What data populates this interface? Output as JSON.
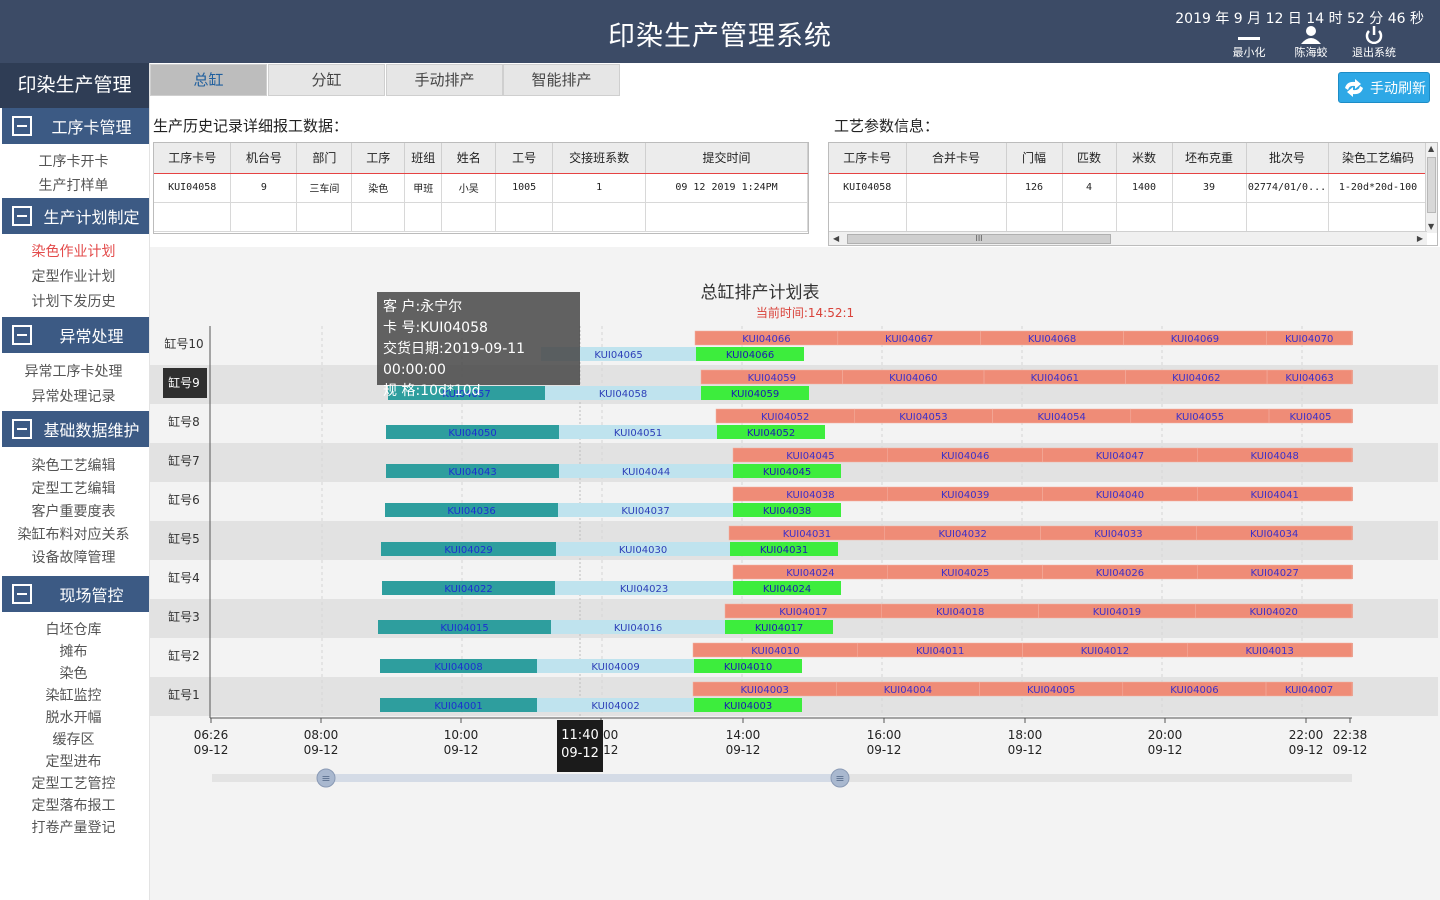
{
  "header": {
    "title": "印染生产管理系统",
    "clock": "2019 年 9 月 12 日  14 时 52 分 46 秒",
    "minimize_label": "最小化",
    "user_label": "陈海蛟",
    "exit_label": "退出系统",
    "icons": [
      "minimize-icon",
      "user-icon",
      "power-icon"
    ]
  },
  "sidebar": {
    "title": "印染生产管理",
    "sections": [
      {
        "label": "工序卡管理",
        "items": [
          {
            "label": "工序卡开卡"
          },
          {
            "label": "生产打样单"
          }
        ]
      },
      {
        "label": "生产计划制定",
        "items": [
          {
            "label": "染色作业计划",
            "active": true
          },
          {
            "label": "定型作业计划"
          },
          {
            "label": "计划下发历史"
          }
        ]
      },
      {
        "label": "异常处理",
        "items": [
          {
            "label": "异常工序卡处理"
          },
          {
            "label": "异常处理记录"
          }
        ]
      },
      {
        "label": "基础数据维护",
        "items": [
          {
            "label": "染色工艺编辑"
          },
          {
            "label": "定型工艺编辑"
          },
          {
            "label": "客户重要度表"
          },
          {
            "label": "染缸布料对应关系"
          },
          {
            "label": "设备故障管理"
          }
        ]
      },
      {
        "label": "现场管控",
        "items": [
          {
            "label": "白坯仓库"
          },
          {
            "label": "摊布"
          },
          {
            "label": "染色"
          },
          {
            "label": "染缸监控"
          },
          {
            "label": "脱水开幅"
          },
          {
            "label": "缓存区"
          },
          {
            "label": "定型进布"
          },
          {
            "label": "定型工艺管控"
          },
          {
            "label": "定型落布报工"
          },
          {
            "label": "打卷产量登记"
          }
        ]
      }
    ]
  },
  "tabs": [
    {
      "label": "总缸",
      "active": true
    },
    {
      "label": "分缸"
    },
    {
      "label": "手动排产"
    },
    {
      "label": "智能排产"
    }
  ],
  "refresh_label": "手动刷新",
  "history": {
    "title": "生产历史记录详细报工数据：",
    "columns": [
      "工序卡号",
      "机台号",
      "部门",
      "工序",
      "班组",
      "姓名",
      "工号",
      "交接班系数",
      "提交时间"
    ],
    "rows": [
      [
        "KUI04058",
        "9",
        "三车间",
        "染色",
        "甲班",
        "小吴",
        "1005",
        "1",
        "09 12 2019  1:24PM"
      ],
      [
        "",
        "",
        "",
        "",
        "",
        "",
        "",
        "",
        ""
      ]
    ]
  },
  "process": {
    "title": "工艺参数信息：",
    "columns": [
      "工序卡号",
      "合并卡号",
      "门幅",
      "匹数",
      "米数",
      "坯布克重",
      "批次号",
      "染色工艺编码"
    ],
    "rows": [
      [
        "KUI04058",
        "",
        "126",
        "4",
        "1400",
        "39",
        "02774/01/0...",
        "1-20d*20d-100"
      ]
    ],
    "hscroll_label": "III"
  },
  "gantt": {
    "title": "总缸排产计划表",
    "now_label": "当前时间:14:52:1",
    "machines": [
      "缸号10",
      "缸号9",
      "缸号8",
      "缸号7",
      "缸号6",
      "缸号5",
      "缸号4",
      "缸号3",
      "缸号2",
      "缸号1"
    ],
    "selected_machine": "缸号9",
    "time_labels": [
      {
        "time": "06:26",
        "date": "09-12"
      },
      {
        "time": "08:00",
        "date": "09-12"
      },
      {
        "time": "10:00",
        "date": "09-12"
      },
      {
        "time": "12:00",
        "date": "09-12"
      },
      {
        "time": "14:00",
        "date": "09-12"
      },
      {
        "time": "16:00",
        "date": "09-12"
      },
      {
        "time": "18:00",
        "date": "09-12"
      },
      {
        "time": "20:00",
        "date": "09-12"
      },
      {
        "time": "22:00",
        "date": "09-12"
      },
      {
        "time": "22:38",
        "date": "09-12"
      }
    ],
    "cursor": {
      "time": "11:40",
      "date": "09-12"
    },
    "colors": {
      "plan": "#ef8c77",
      "done": "#2e9e9e",
      "waiting": "#bfe3ee",
      "running": "#3ded3d",
      "plan_text": "#3b2fc9",
      "done_text": "#1c2fd0",
      "running_text": "#1b1bb0"
    },
    "rows": [
      {
        "machine": "缸号10",
        "plan": [
          "KUI04066",
          "KUI04067",
          "KUI04068",
          "KUI04069",
          "KUI04070"
        ],
        "actual": [
          {
            "label": "",
            "status": "done"
          },
          {
            "label": "KUI04065",
            "status": "waiting"
          },
          {
            "label": "KUI04066",
            "status": "running"
          }
        ]
      },
      {
        "machine": "缸号9",
        "plan": [
          "KUI04059",
          "KUI04060",
          "KUI04061",
          "KUI04062",
          "KUI04063"
        ],
        "actual": [
          {
            "label": "KUI04057",
            "status": "done"
          },
          {
            "label": "KUI04058",
            "status": "waiting"
          },
          {
            "label": "KUI04059",
            "status": "running"
          }
        ]
      },
      {
        "machine": "缸号8",
        "plan": [
          "KUI04052",
          "KUI04053",
          "KUI04054",
          "KUI04055",
          "KUI0405"
        ],
        "actual": [
          {
            "label": "KUI04050",
            "status": "done"
          },
          {
            "label": "KUI04051",
            "status": "waiting"
          },
          {
            "label": "KUI04052",
            "status": "running"
          }
        ]
      },
      {
        "machine": "缸号7",
        "plan": [
          "KUI04045",
          "KUI04046",
          "KUI04047",
          "KUI04048"
        ],
        "actual": [
          {
            "label": "KUI04043",
            "status": "done"
          },
          {
            "label": "KUI04044",
            "status": "waiting"
          },
          {
            "label": "KUI04045",
            "status": "running"
          }
        ]
      },
      {
        "machine": "缸号6",
        "plan": [
          "KUI04038",
          "KUI04039",
          "KUI04040",
          "KUI04041"
        ],
        "actual": [
          {
            "label": "KUI04036",
            "status": "done"
          },
          {
            "label": "KUI04037",
            "status": "waiting"
          },
          {
            "label": "KUI04038",
            "status": "running"
          }
        ]
      },
      {
        "machine": "缸号5",
        "plan": [
          "KUI04031",
          "KUI04032",
          "KUI04033",
          "KUI04034"
        ],
        "actual": [
          {
            "label": "KUI04029",
            "status": "done"
          },
          {
            "label": "KUI04030",
            "status": "waiting"
          },
          {
            "label": "KUI04031",
            "status": "running"
          }
        ]
      },
      {
        "machine": "缸号4",
        "plan": [
          "KUI04024",
          "KUI04025",
          "KUI04026",
          "KUI04027"
        ],
        "actual": [
          {
            "label": "KUI04022",
            "status": "done"
          },
          {
            "label": "KUI04023",
            "status": "waiting"
          },
          {
            "label": "KUI04024",
            "status": "running"
          }
        ]
      },
      {
        "machine": "缸号3",
        "plan": [
          "KUI04017",
          "KUI04018",
          "KUI04019",
          "KUI04020"
        ],
        "actual": [
          {
            "label": "KUI04015",
            "status": "done"
          },
          {
            "label": "KUI04016",
            "status": "waiting"
          },
          {
            "label": "KUI04017",
            "status": "running"
          }
        ]
      },
      {
        "machine": "缸号2",
        "plan": [
          "KUI04010",
          "KUI04011",
          "KUI04012",
          "KUI04013"
        ],
        "actual": [
          {
            "label": "KUI04008",
            "status": "done"
          },
          {
            "label": "KUI04009",
            "status": "waiting"
          },
          {
            "label": "KUI04010",
            "status": "running"
          }
        ]
      },
      {
        "machine": "缸号1",
        "plan": [
          "KUI04003",
          "KUI04004",
          "KUI04005",
          "KUI04006",
          "KUI04007"
        ],
        "actual": [
          {
            "label": "KUI04001",
            "status": "done"
          },
          {
            "label": "KUI04002",
            "status": "waiting"
          },
          {
            "label": "KUI04003",
            "status": "running"
          }
        ]
      }
    ],
    "tooltip": {
      "customer": "客 户:永宁尔",
      "card": "卡 号:KUI04058",
      "delivery": "交货日期:2019-09-11 00:00:00",
      "spec": "规 格:10d*10d"
    }
  }
}
